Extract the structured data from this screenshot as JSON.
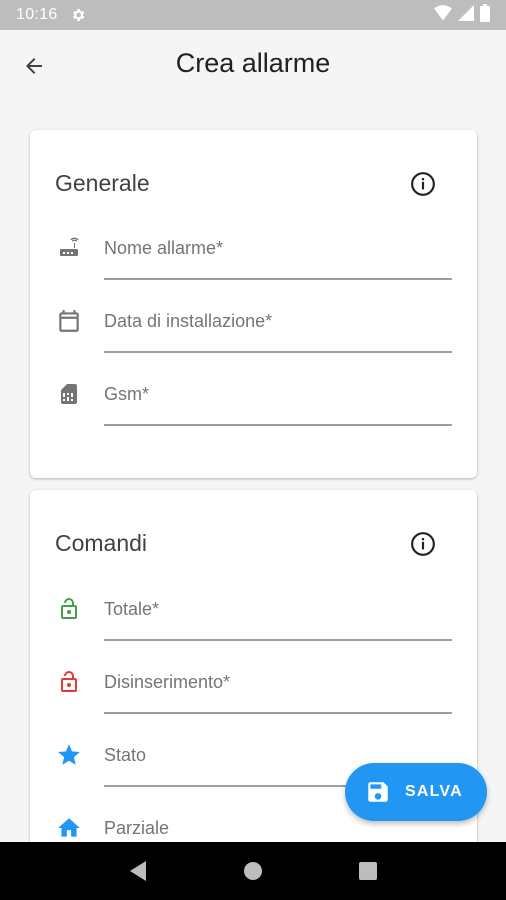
{
  "status_bar": {
    "time": "10:16",
    "icons": [
      "gear-icon",
      "wifi-icon",
      "signal-icon",
      "battery-icon"
    ]
  },
  "app_bar": {
    "title": "Crea allarme",
    "back_icon": "arrow-back-icon"
  },
  "sections": [
    {
      "title": "Generale",
      "info_icon": "info-icon",
      "fields": [
        {
          "label": "Nome allarme*",
          "icon": "router-icon",
          "icon_color": "#757575",
          "value": ""
        },
        {
          "label": "Data di installazione*",
          "icon": "calendar-icon",
          "icon_color": "#757575",
          "value": ""
        },
        {
          "label": "Gsm*",
          "icon": "sim-card-icon",
          "icon_color": "#757575",
          "value": ""
        }
      ]
    },
    {
      "title": "Comandi",
      "info_icon": "info-icon",
      "fields": [
        {
          "label": "Totale*",
          "icon": "lock-open-icon",
          "icon_color": "#43a047",
          "value": ""
        },
        {
          "label": "Disinserimento*",
          "icon": "lock-open-icon",
          "icon_color": "#e53935",
          "value": ""
        },
        {
          "label": "Stato",
          "icon": "star-icon",
          "icon_color": "#2196f3",
          "value": ""
        },
        {
          "label": "Parziale",
          "icon": "home-icon",
          "icon_color": "#2196f3",
          "value": ""
        }
      ]
    }
  ],
  "fab": {
    "label": "SALVA",
    "icon": "save-icon",
    "color": "#2196f3"
  },
  "nav_bar": {
    "icons": [
      "nav-back-icon",
      "nav-home-icon",
      "nav-recents-icon"
    ]
  }
}
